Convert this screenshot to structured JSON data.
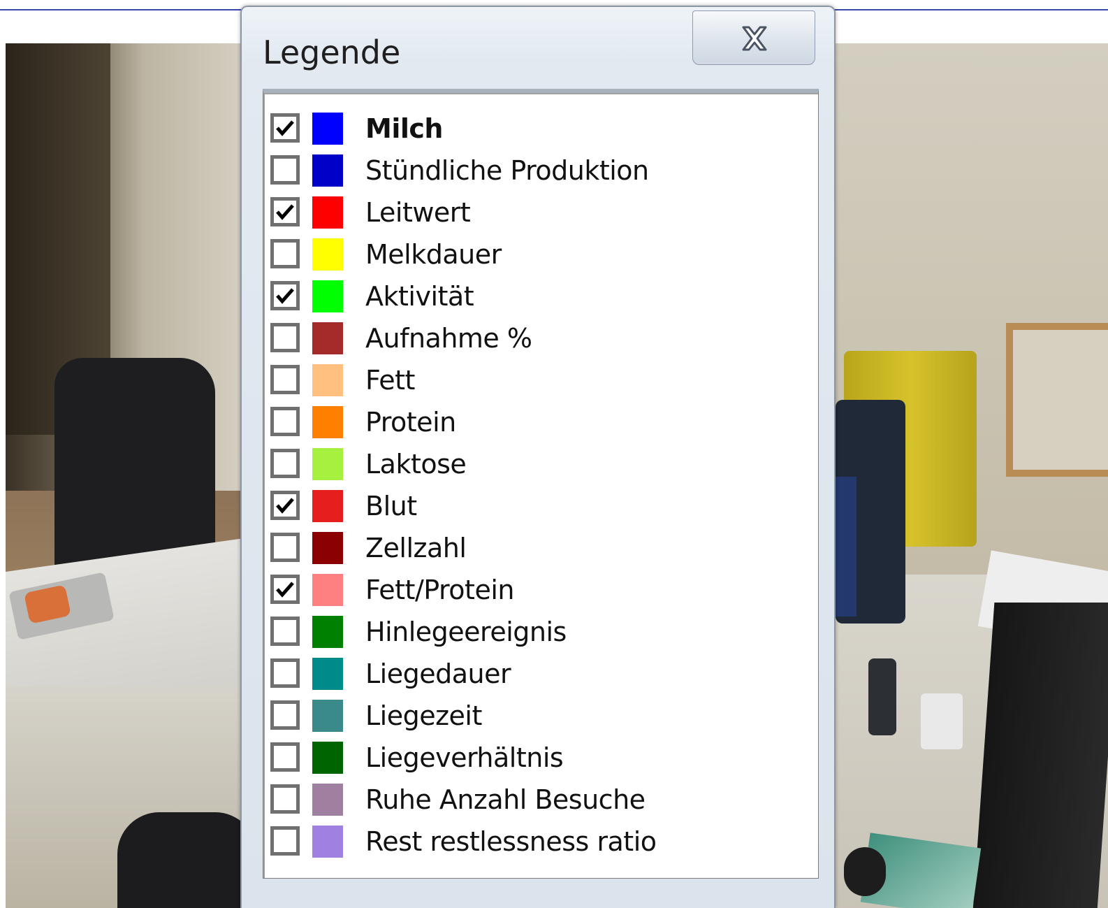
{
  "window": {
    "title": "Legende"
  },
  "legend": {
    "items": [
      {
        "label": "Milch",
        "checked": true,
        "color": "#0000ff",
        "bold": true
      },
      {
        "label": "Stündliche Produktion",
        "checked": false,
        "color": "#0000c8",
        "bold": false
      },
      {
        "label": "Leitwert",
        "checked": true,
        "color": "#ff0000",
        "bold": false
      },
      {
        "label": "Melkdauer",
        "checked": false,
        "color": "#ffff00",
        "bold": false
      },
      {
        "label": "Aktivität",
        "checked": true,
        "color": "#00ff00",
        "bold": false
      },
      {
        "label": "Aufnahme %",
        "checked": false,
        "color": "#a52a2a",
        "bold": false
      },
      {
        "label": "Fett",
        "checked": false,
        "color": "#ffc080",
        "bold": false
      },
      {
        "label": "Protein",
        "checked": false,
        "color": "#ff8000",
        "bold": false
      },
      {
        "label": "Laktose",
        "checked": false,
        "color": "#a6f040",
        "bold": false
      },
      {
        "label": "Blut",
        "checked": true,
        "color": "#e61e1e",
        "bold": false
      },
      {
        "label": "Zellzahl",
        "checked": false,
        "color": "#8b0000",
        "bold": false
      },
      {
        "label": "Fett/Protein",
        "checked": true,
        "color": "#ff8080",
        "bold": false
      },
      {
        "label": "Hinlegeereignis",
        "checked": false,
        "color": "#008000",
        "bold": false
      },
      {
        "label": "Liegedauer",
        "checked": false,
        "color": "#008b8b",
        "bold": false
      },
      {
        "label": "Liegezeit",
        "checked": false,
        "color": "#3a8a8a",
        "bold": false
      },
      {
        "label": "Liegeverhältnis",
        "checked": false,
        "color": "#006400",
        "bold": false
      },
      {
        "label": "Ruhe Anzahl Besuche",
        "checked": false,
        "color": "#a080a0",
        "bold": false
      },
      {
        "label": "Rest restlessness ratio",
        "checked": false,
        "color": "#a080e0",
        "bold": false
      }
    ]
  },
  "icons": {
    "close": "close-icon",
    "check": "checkmark-icon"
  }
}
